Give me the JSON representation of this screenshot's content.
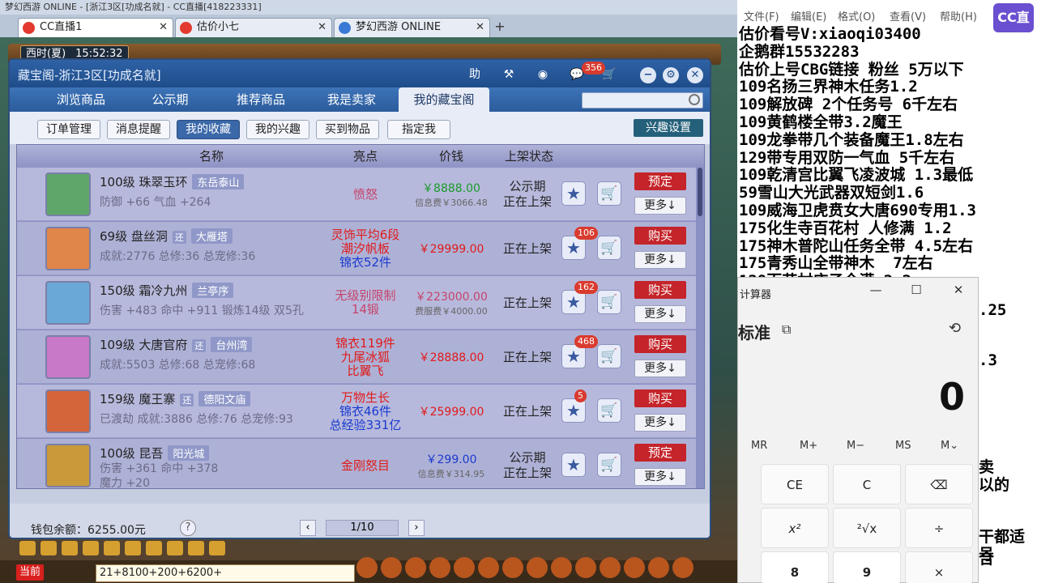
{
  "browser": {
    "title": "梦幻西游 ONLINE - [浙江3区[功成名就] - CC直播[418223331]",
    "tabs": [
      {
        "label": "CC直播1"
      },
      {
        "label": "估价小七"
      },
      {
        "label": "梦幻西游 ONLINE"
      }
    ]
  },
  "game": {
    "time": "西时(夏)",
    "clock": "15:52:32"
  },
  "panel": {
    "title": "藏宝阁-浙江3区[功成名就]",
    "help_label": "助",
    "cart_count": "356",
    "nav": [
      "浏览商品",
      "公示期",
      "推荐商品",
      "我是卖家",
      "我的藏宝阁"
    ],
    "sub": [
      "订单管理",
      "消息提醒",
      "我的收藏",
      "我的兴趣",
      "买到物品",
      "指定我"
    ],
    "interest_btn": "兴趣设置",
    "headers": [
      "名称",
      "亮点",
      "价钱",
      "上架状态"
    ],
    "rows": [
      {
        "title": "100级 珠翠玉环",
        "tag": "东岳泰山",
        "line2": "防御 +66 气血 +264",
        "hl": [
          "愤怒"
        ],
        "hl_color": "#c6436a",
        "price": "￥8888.00",
        "price_color": "#1a9a2a",
        "fee": "信息费￥3066.48",
        "status": [
          "公示期",
          "正在上架"
        ],
        "action": "预定",
        "more": "更多↓"
      },
      {
        "title": "69级 盘丝洞",
        "huan": "还",
        "tag": "大雁塔",
        "line2": "成就:2776 总修:36 总宠修:36",
        "hl": [
          "灵饰平均6段",
          "潮汐帆板",
          "锦衣52件"
        ],
        "hl_colors": [
          "#e01a1a",
          "#e01a1a",
          "#1a3ad0"
        ],
        "price": "￥29999.00",
        "price_color": "#e01a1a",
        "badge": "106",
        "status": [
          "正在上架"
        ],
        "action": "购买",
        "more": "更多↓"
      },
      {
        "title": "150级 霜冷九州",
        "tag": "兰亭序",
        "line2": "伤害 +483 命中 +911 锻炼14级 双5孔",
        "hl": [
          "无级别限制",
          "14锻"
        ],
        "hl_color": "#c6436a",
        "price": "￥223000.00",
        "price_color": "#c6436a",
        "fee": "费服费￥4000.00",
        "badge": "162",
        "status": [
          "正在上架"
        ],
        "action": "购买",
        "more": "更多↓"
      },
      {
        "title": "109级 大唐官府",
        "huan": "还",
        "tag": "台州湾",
        "line2": "成就:5503 总修:68 总宠修:68",
        "hl": [
          "锦衣119件",
          "九尾冰狐",
          "比翼飞"
        ],
        "hl_color": "#e01a1a",
        "price": "￥28888.00",
        "price_color": "#e01a1a",
        "badge": "468",
        "status": [
          "正在上架"
        ],
        "action": "购买",
        "more": "更多↓"
      },
      {
        "title": "159级 魔王寨",
        "huan": "还",
        "tag": "德阳文庙",
        "line2": "已渡劫 成就:3886 总修:76 总宠修:93",
        "hl": [
          "万物生长",
          "锦衣46件",
          "总经验331亿"
        ],
        "hl_colors": [
          "#e01a1a",
          "#1a3ad0",
          "#1a3ad0"
        ],
        "price": "￥25999.00",
        "price_color": "#e01a1a",
        "badge": "5",
        "status": [
          "正在上架"
        ],
        "action": "购买",
        "more": "更多↓"
      },
      {
        "title": "100级 昆吾",
        "tag": "阳光城",
        "line2": "伤害 +361 命中 +378",
        "line3": "魔力 +20",
        "hl": [
          "金刚怒目"
        ],
        "hl_color": "#e01a1a",
        "price": "￥299.00",
        "price_color": "#1a3ad0",
        "fee": "信息费￥314.95",
        "status": [
          "公示期",
          "正在上架"
        ],
        "action": "预定",
        "more": "更多↓"
      }
    ],
    "wallet": "钱包余额：6255.00元",
    "page": "1/10"
  },
  "chat": {
    "mode": "当前",
    "input": "21+8100+200+6200+"
  },
  "notepad": {
    "menu": [
      "文件(F)",
      "编辑(E)",
      "格式(O)",
      "查看(V)",
      "帮助(H)"
    ],
    "lines": [
      "估价看号V:xiaoqi03400",
      "企鹅群15532283",
      "估价上号CBG链接 粉丝 5万以下",
      "109名扬三界神木任务1.2",
      "109解放碑 2个任务号 6千左右",
      "109黄鹤楼全带3.2魔王",
      "109龙拳带几个装备魔王1.8左右",
      "129带专用双防一气血 5千左右",
      "109乾清宫比翼飞凌波城 1.3最低",
      "59雪山大光武器双短剑1.6",
      "109威海卫虎贲女大唐690专用1.3",
      "175化生寺百花村 人修满 1.2",
      "175神木普陀山任务全带 4.5左右",
      "175青秀山全带神木  7左右",
      "129百花村庄子全满 2.2"
    ],
    "behind": [
      ".25",
      ".3",
      "卖",
      "以的",
      "干都适合",
      "号"
    ]
  },
  "cc_logo": "CC直播",
  "calculator": {
    "title": "计算器",
    "mode": "标准",
    "display": "0",
    "memory": [
      "MR",
      "M+",
      "M−",
      "MS",
      "M⌄"
    ],
    "keys": [
      "CE",
      "C",
      "⌫",
      "x²",
      "²√x",
      "÷",
      "8",
      "9",
      "×"
    ]
  }
}
